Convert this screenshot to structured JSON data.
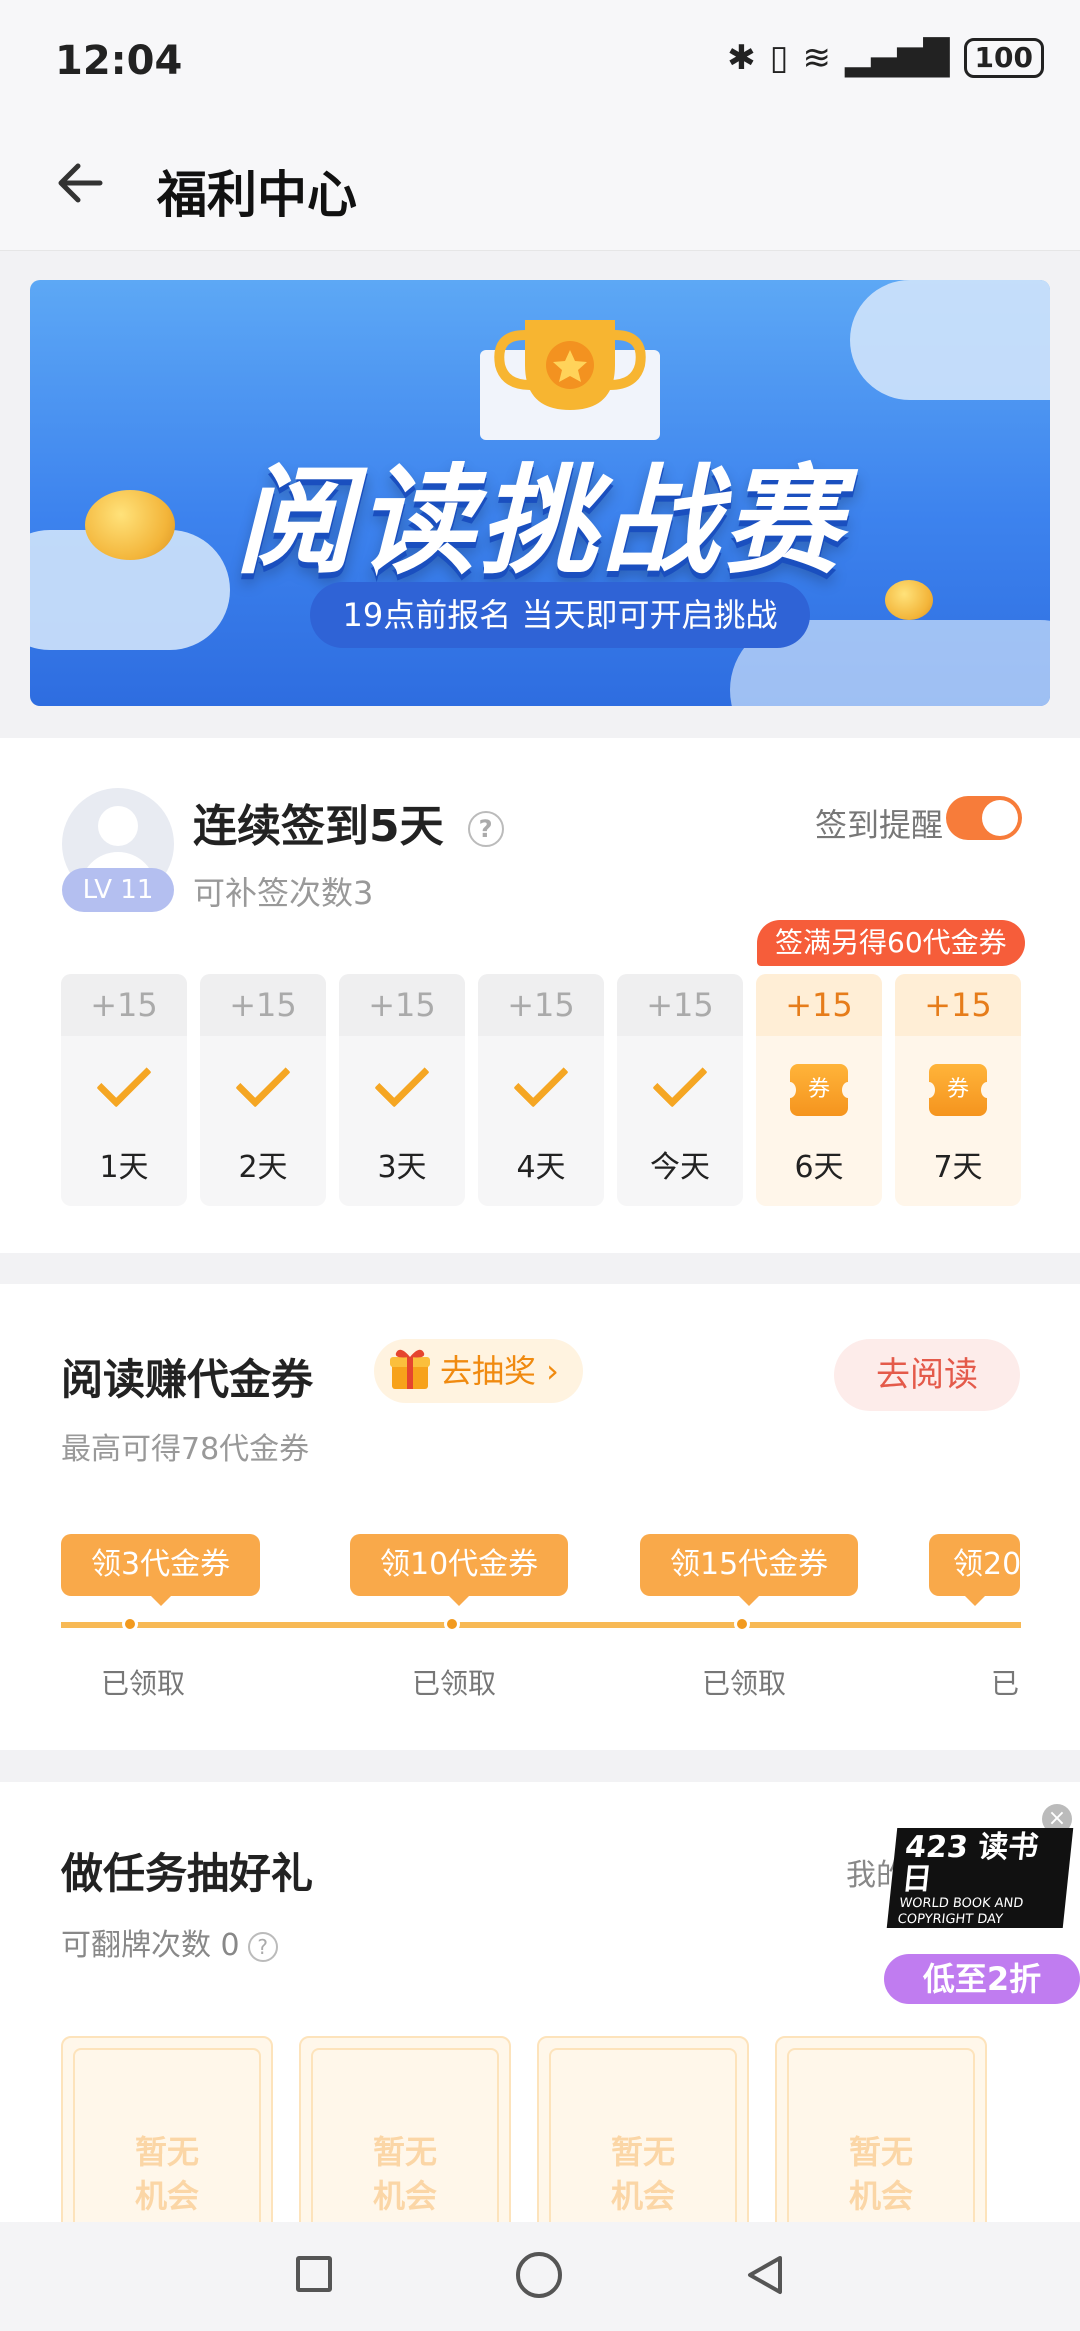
{
  "status_bar": {
    "time": "12:04",
    "battery": "100"
  },
  "header": {
    "title": "福利中心"
  },
  "banner": {
    "title": "阅读挑战赛",
    "subtitle": "19点前报名 当天即可开启挑战"
  },
  "signin": {
    "title": "连续签到5天",
    "makeup": "可补签次数3",
    "level": "LV 11",
    "remind_label": "签到提醒",
    "reminder_on": true,
    "bonus_tag": "签满另得60代金券",
    "ticket_char": "券",
    "days": [
      {
        "points": "+15",
        "label": "1天"
      },
      {
        "points": "+15",
        "label": "2天"
      },
      {
        "points": "+15",
        "label": "3天"
      },
      {
        "points": "+15",
        "label": "4天"
      },
      {
        "points": "+15",
        "label": "今天"
      },
      {
        "points": "+15",
        "label": "6天"
      },
      {
        "points": "+15",
        "label": "7天"
      }
    ]
  },
  "reading": {
    "title": "阅读赚代金券",
    "lottery": "去抽奖 ›",
    "button": "去阅读",
    "subtitle": "最高可得78代金券",
    "milestones": [
      {
        "tag": "领3代金券",
        "status": "已领取"
      },
      {
        "tag": "领10代金券",
        "status": "已领取"
      },
      {
        "tag": "领15代金券",
        "status": "已领取"
      },
      {
        "tag": "领20",
        "status": "已"
      }
    ]
  },
  "tasks": {
    "title": "做任务抽好礼",
    "subtitle": "可翻牌次数 0",
    "my_prize": "我的",
    "promo": {
      "number": "423",
      "day": "读书日",
      "en": "WORLD BOOK AND COPYRIGHT DAY",
      "deal": "低至2折",
      "close": "×"
    },
    "cards": [
      {
        "line1": "暂无",
        "line2": "机会"
      },
      {
        "line1": "暂无",
        "line2": "机会"
      },
      {
        "line1": "暂无",
        "line2": "机会"
      },
      {
        "line1": "暂无",
        "line2": "机会"
      }
    ]
  },
  "colors": {
    "accent": "#f5a623",
    "toggle": "#f77c3a",
    "danger": "#e45a4a",
    "banner": "#3d83ee"
  }
}
